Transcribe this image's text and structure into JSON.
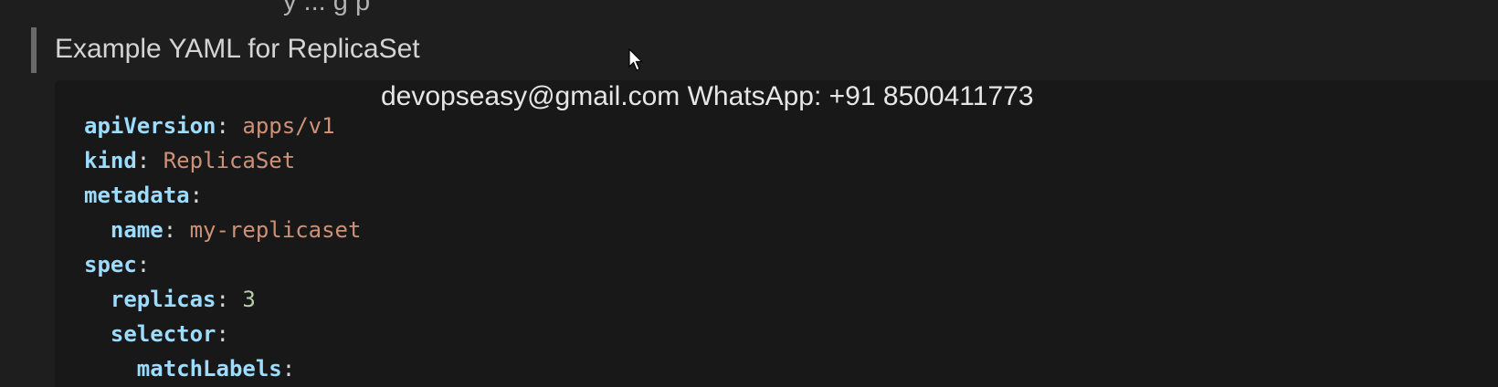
{
  "top_fragment": "y ... g p",
  "heading": "Example YAML for ReplicaSet",
  "watermark": "devopseasy@gmail.com WhatsApp: +91 8500411773",
  "code_lines": [
    {
      "indent": "",
      "key": "apiVersion",
      "value": "apps/v1",
      "value_type": "string"
    },
    {
      "indent": "",
      "key": "kind",
      "value": "ReplicaSet",
      "value_type": "string"
    },
    {
      "indent": "",
      "key": "metadata",
      "value": "",
      "value_type": "none"
    },
    {
      "indent": "  ",
      "key": "name",
      "value": "my-replicaset",
      "value_type": "string"
    },
    {
      "indent": "",
      "key": "spec",
      "value": "",
      "value_type": "none"
    },
    {
      "indent": "  ",
      "key": "replicas",
      "value": "3",
      "value_type": "number"
    },
    {
      "indent": "  ",
      "key": "selector",
      "value": "",
      "value_type": "none"
    },
    {
      "indent": "    ",
      "key": "matchLabels",
      "value": "",
      "value_type": "none"
    }
  ],
  "colors": {
    "background": "#1e1e1e",
    "code_background": "#181818",
    "yaml_key": "#9cdcfe",
    "yaml_string": "#ce9178",
    "yaml_number": "#b5cea8",
    "heading_bar": "#6a6a6a"
  },
  "icons": {
    "cursor": "mouse-pointer-icon"
  }
}
